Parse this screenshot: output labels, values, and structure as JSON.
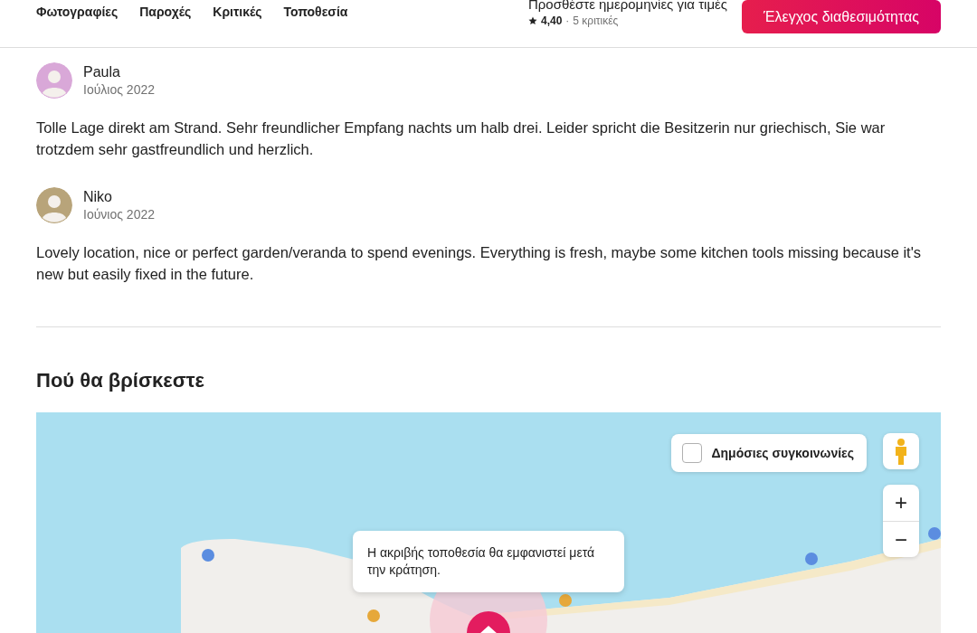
{
  "nav": {
    "links": [
      {
        "label": "Φωτογραφίες"
      },
      {
        "label": "Παροχές"
      },
      {
        "label": "Κριτικές"
      },
      {
        "label": "Τοποθεσία"
      }
    ],
    "price_prompt": "Προσθέστε ημερομηνίες για τιμές",
    "rating": "4,40",
    "separator": "·",
    "reviews_link": "5 κριτικές",
    "cta": "Έλεγχος διαθεσιμότητας"
  },
  "reviews": [
    {
      "name": "Paula",
      "date": "Ιούλιος 2022",
      "text": "Tolle Lage direkt am Strand. Sehr freundlicher Empfang nachts um halb drei. Leider spricht die Besitzerin nur griechisch, Sie war trotzdem sehr gastfreundlich und herzlich."
    },
    {
      "name": "Niko",
      "date": "Ιούνιος 2022",
      "text": "Lovely location, nice or perfect garden/veranda to spend evenings. Everything is fresh, maybe some kitchen tools missing because it's new but easily fixed in the future."
    }
  ],
  "location": {
    "heading": "Πού θα βρίσκεστε",
    "transit": {
      "label": "Δημόσιες συγκοινωνίες",
      "checked": false
    },
    "zoom_in": "+",
    "zoom_out": "−",
    "tooltip": "Η ακριβής τοποθεσία θα εμφανιστεί μετά την κράτηση."
  }
}
